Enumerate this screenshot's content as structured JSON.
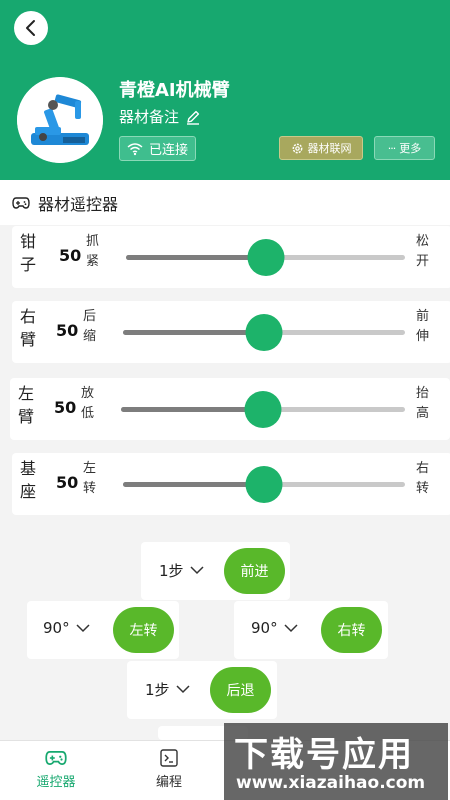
{
  "header": {
    "back_icon": "chevron-left-icon",
    "title": "青橙AI机械臂",
    "note": "器材备注",
    "status": "已连接",
    "iot_label": "器材联网",
    "more_label": "更多",
    "accent": "#17a86f"
  },
  "section": {
    "title": "器材遥控器"
  },
  "sliders": [
    {
      "name": "钳子",
      "value": "50",
      "left_label": "抓紧",
      "right_label": "松开",
      "level": 0.5
    },
    {
      "name": "右臂",
      "value": "50",
      "left_label": "后缩",
      "right_label": "前伸",
      "level": 0.5
    },
    {
      "name": "左臂",
      "value": "50",
      "left_label": "放低",
      "right_label": "抬高",
      "level": 0.5
    },
    {
      "name": "基座",
      "value": "50",
      "left_label": "左转",
      "right_label": "右转",
      "level": 0.5
    }
  ],
  "controls": {
    "forward": {
      "step": "1步",
      "button": "前进"
    },
    "left": {
      "step": "90°",
      "button": "左转"
    },
    "right": {
      "step": "90°",
      "button": "右转"
    },
    "backward": {
      "step": "1步",
      "button": "后退"
    },
    "button_color": "#59b82a"
  },
  "nav": {
    "items": [
      {
        "label": "遥控器",
        "icon": "gamepad-icon",
        "active": true
      },
      {
        "label": "编程",
        "icon": "terminal-icon",
        "active": false
      }
    ]
  },
  "watermark": {
    "main": "下载号应用",
    "url": "www.xiazaihao.com"
  }
}
